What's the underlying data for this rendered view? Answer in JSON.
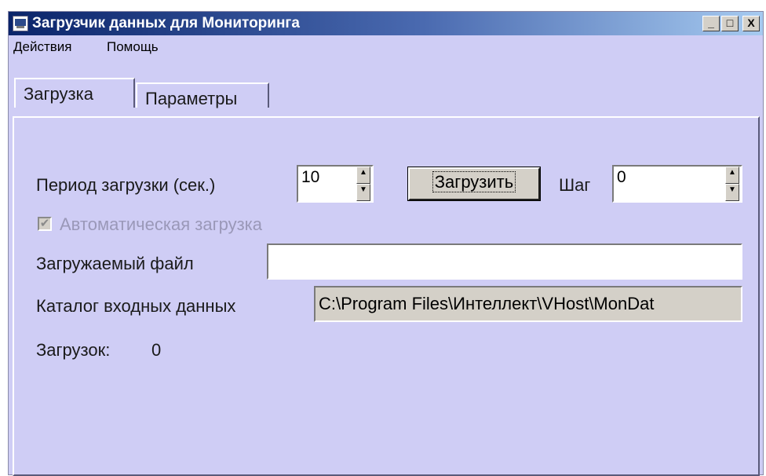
{
  "window": {
    "title": "Загрузчик данных для Мониторинга",
    "controls": {
      "minimize": "_",
      "maximize": "□",
      "close": "X"
    }
  },
  "menu": {
    "items": [
      "Действия",
      "Помощь"
    ]
  },
  "tabs": [
    {
      "label": "Загрузка",
      "active": true
    },
    {
      "label": "Параметры",
      "active": false
    }
  ],
  "form": {
    "period_label": "Период загрузки (сек.)",
    "period_value": "10",
    "load_button": "Загрузить",
    "step_label": "Шаг",
    "step_value": "0",
    "auto_load_label": "Автоматическая загрузка",
    "auto_load_checked": true,
    "file_label": "Загружаемый файл",
    "file_value": "",
    "dir_label": "Каталог входных данных",
    "dir_value": "C:\\Program Files\\Интеллект\\VHost\\MonDat",
    "count_label": "Загрузок:",
    "count_value": "0"
  },
  "colors": {
    "background": "#cfcdf5",
    "titlebar": "#0a246a"
  }
}
